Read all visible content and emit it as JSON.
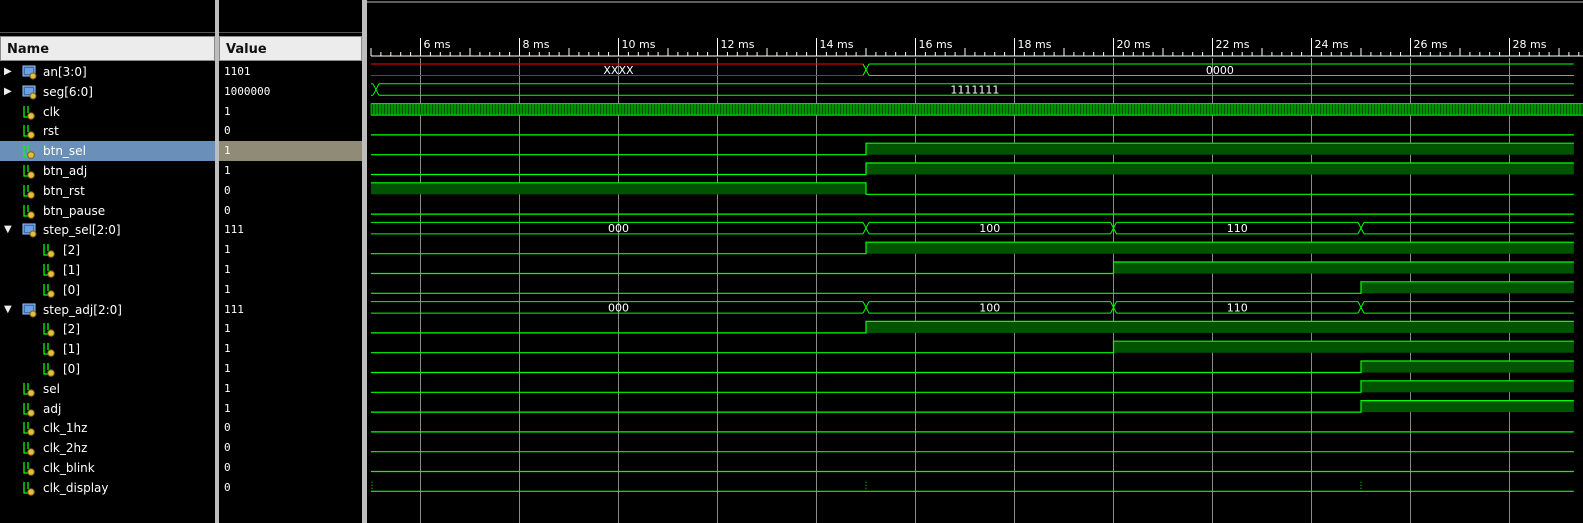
{
  "columns": {
    "name": "Name",
    "value": "Value"
  },
  "colors": {
    "background": "#000000",
    "wave": "#00ff00",
    "wave_fill": "#005400",
    "undefined": "#ff0000",
    "gridline": "#8a8a8a",
    "selected_row": "#6a8fb8",
    "selected_value": "#8f8b76"
  },
  "time_axis": {
    "unit": "ms",
    "ticks": [
      "6 ms",
      "8 ms",
      "10 ms",
      "12 ms",
      "14 ms",
      "16 ms",
      "18 ms",
      "20 ms",
      "22 ms",
      "24 ms",
      "26 ms",
      "28 ms"
    ]
  },
  "signals": [
    {
      "name": "an[3:0]",
      "value": "1101",
      "kind": "bus",
      "expanded": false,
      "icon": "bus-icon"
    },
    {
      "name": "seg[6:0]",
      "value": "1000000",
      "kind": "bus",
      "expanded": false,
      "icon": "bus-icon"
    },
    {
      "name": "clk",
      "value": "1",
      "kind": "bit",
      "icon": "wire-in-icon"
    },
    {
      "name": "rst",
      "value": "0",
      "kind": "bit",
      "icon": "wire-in-icon"
    },
    {
      "name": "btn_sel",
      "value": "1",
      "kind": "bit",
      "icon": "wire-in-icon",
      "selected": true
    },
    {
      "name": "btn_adj",
      "value": "1",
      "kind": "bit",
      "icon": "wire-in-icon"
    },
    {
      "name": "btn_rst",
      "value": "0",
      "kind": "bit",
      "icon": "wire-in-icon"
    },
    {
      "name": "btn_pause",
      "value": "0",
      "kind": "bit",
      "icon": "wire-in-icon"
    },
    {
      "name": "step_sel[2:0]",
      "value": "111",
      "kind": "bus",
      "expanded": true,
      "icon": "bus-icon"
    },
    {
      "name": "[2]",
      "value": "1",
      "kind": "bit",
      "child": true,
      "icon": "wire-in-icon"
    },
    {
      "name": "[1]",
      "value": "1",
      "kind": "bit",
      "child": true,
      "icon": "wire-in-icon"
    },
    {
      "name": "[0]",
      "value": "1",
      "kind": "bit",
      "child": true,
      "icon": "wire-in-icon"
    },
    {
      "name": "step_adj[2:0]",
      "value": "111",
      "kind": "bus",
      "expanded": true,
      "icon": "bus-icon"
    },
    {
      "name": "[2]",
      "value": "1",
      "kind": "bit",
      "child": true,
      "icon": "wire-in-icon"
    },
    {
      "name": "[1]",
      "value": "1",
      "kind": "bit",
      "child": true,
      "icon": "wire-in-icon"
    },
    {
      "name": "[0]",
      "value": "1",
      "kind": "bit",
      "child": true,
      "icon": "wire-in-icon"
    },
    {
      "name": "sel",
      "value": "1",
      "kind": "bit",
      "icon": "wire-out-icon"
    },
    {
      "name": "adj",
      "value": "1",
      "kind": "bit",
      "icon": "wire-out-icon"
    },
    {
      "name": "clk_1hz",
      "value": "0",
      "kind": "bit",
      "icon": "wire-out-icon"
    },
    {
      "name": "clk_2hz",
      "value": "0",
      "kind": "bit",
      "icon": "wire-out-icon"
    },
    {
      "name": "clk_blink",
      "value": "0",
      "kind": "bit",
      "icon": "wire-out-icon"
    },
    {
      "name": "clk_display",
      "value": "0",
      "kind": "bit",
      "icon": "wire-out-icon"
    }
  ],
  "waveforms": [
    {
      "type": "bus",
      "segments": [
        {
          "from": 5.0,
          "to": 15.0,
          "label": "XXXX",
          "undefined": true
        },
        {
          "from": 15.0,
          "to": 29.3,
          "label": "0000"
        }
      ]
    },
    {
      "type": "bus",
      "segments": [
        {
          "from": 5.0,
          "to": 5.1,
          "label": ""
        },
        {
          "from": 5.1,
          "to": 29.3,
          "label": "1111111"
        }
      ]
    },
    {
      "type": "clock"
    },
    {
      "type": "bit",
      "transitions": [
        [
          5.0,
          0
        ]
      ]
    },
    {
      "type": "bit",
      "transitions": [
        [
          5.0,
          0
        ],
        [
          15.0,
          1
        ]
      ]
    },
    {
      "type": "bit",
      "transitions": [
        [
          5.0,
          0
        ],
        [
          15.0,
          1
        ]
      ]
    },
    {
      "type": "bit",
      "transitions": [
        [
          5.0,
          1
        ],
        [
          15.0,
          0
        ]
      ]
    },
    {
      "type": "bit",
      "transitions": [
        [
          5.0,
          0
        ]
      ]
    },
    {
      "type": "bus",
      "segments": [
        {
          "from": 5.0,
          "to": 15.0,
          "label": "000"
        },
        {
          "from": 15.0,
          "to": 20.0,
          "label": "100"
        },
        {
          "from": 20.0,
          "to": 25.0,
          "label": "110"
        },
        {
          "from": 25.0,
          "to": 29.3,
          "label": ""
        }
      ]
    },
    {
      "type": "bit",
      "transitions": [
        [
          5.0,
          0
        ],
        [
          15.0,
          1
        ]
      ]
    },
    {
      "type": "bit",
      "transitions": [
        [
          5.0,
          0
        ],
        [
          20.0,
          1
        ]
      ]
    },
    {
      "type": "bit",
      "transitions": [
        [
          5.0,
          0
        ],
        [
          25.0,
          1
        ]
      ]
    },
    {
      "type": "bus",
      "segments": [
        {
          "from": 5.0,
          "to": 15.0,
          "label": "000"
        },
        {
          "from": 15.0,
          "to": 20.0,
          "label": "100"
        },
        {
          "from": 20.0,
          "to": 25.0,
          "label": "110"
        },
        {
          "from": 25.0,
          "to": 29.3,
          "label": ""
        }
      ]
    },
    {
      "type": "bit",
      "transitions": [
        [
          5.0,
          0
        ],
        [
          15.0,
          1
        ]
      ]
    },
    {
      "type": "bit",
      "transitions": [
        [
          5.0,
          0
        ],
        [
          20.0,
          1
        ]
      ]
    },
    {
      "type": "bit",
      "transitions": [
        [
          5.0,
          0
        ],
        [
          25.0,
          1
        ]
      ]
    },
    {
      "type": "bit",
      "transitions": [
        [
          5.0,
          0
        ],
        [
          25.0,
          1
        ]
      ]
    },
    {
      "type": "bit",
      "transitions": [
        [
          5.0,
          0
        ],
        [
          25.0,
          1
        ]
      ]
    },
    {
      "type": "bit",
      "transitions": [
        [
          5.0,
          0
        ]
      ]
    },
    {
      "type": "bit",
      "transitions": [
        [
          5.0,
          0
        ]
      ]
    },
    {
      "type": "bit",
      "transitions": [
        [
          5.0,
          0
        ]
      ]
    },
    {
      "type": "bit",
      "transitions": [
        [
          5.0,
          0
        ]
      ],
      "glitches": [
        5.0,
        15.0,
        25.0
      ]
    }
  ]
}
